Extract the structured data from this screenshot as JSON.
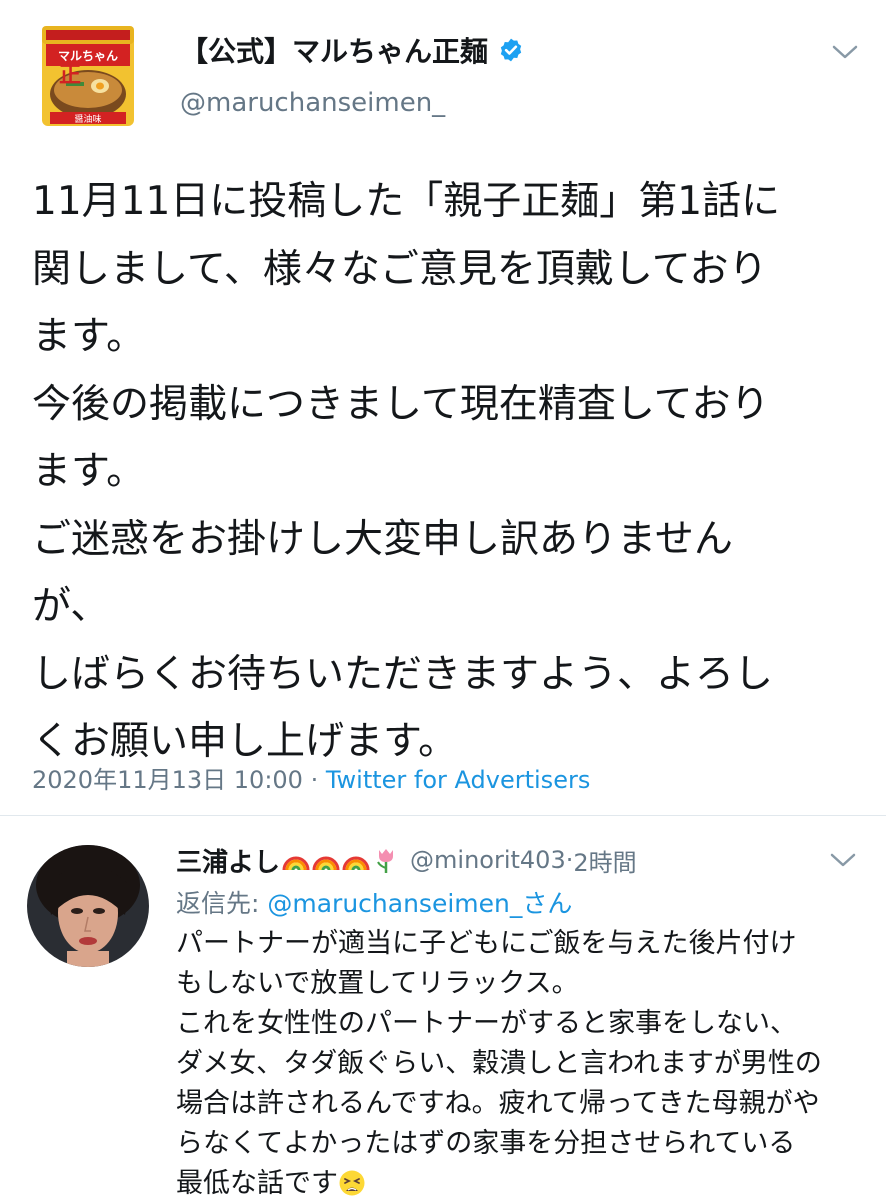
{
  "main_tweet": {
    "author_name": "【公式】マルちゃん正麺",
    "handle": "@maruchanseimen_",
    "body_lines": [
      "11月11日に投稿した「親子正麺」第1話に",
      "関しまして、様々なご意見を頂戴しており",
      "ます。",
      "今後の掲載につきまして現在精査しており",
      "ます。",
      "ご迷惑をお掛けし大変申し訳ありません",
      "が、",
      "しばらくお待ちいただきますよう、よろし",
      "くお願い申し上げます。"
    ],
    "timestamp": "2020年11月13日 10:00",
    "separator": " · ",
    "source": "Twitter for Advertisers",
    "product_label": "マルちゃん",
    "product_kanji": "正麺",
    "product_flavor": "醤油味"
  },
  "reply": {
    "author_name": "三浦よし",
    "handle": "@minorit403",
    "time_ago": "2時間",
    "time_sep": " · ",
    "reply_to_prefix": "返信先: ",
    "reply_to_mention": "@maruchanseimen_さん",
    "body_lines": [
      "パートナーが適当に子どもにご飯を与えた後片付け",
      "もしないで放置してリラックス。",
      "これを女性性のパートナーがすると家事をしない、",
      "ダメ女、タダ飯ぐらい、穀潰しと言われますが男性の",
      "場合は許されるんですね。疲れて帰ってきた母親がや",
      "らなくてよかったはずの家事を分担させられている",
      "最低な話です"
    ]
  },
  "colors": {
    "text": "#14171a",
    "secondary": "#657786",
    "link": "#1b95e0",
    "verified": "#1da1f2"
  }
}
